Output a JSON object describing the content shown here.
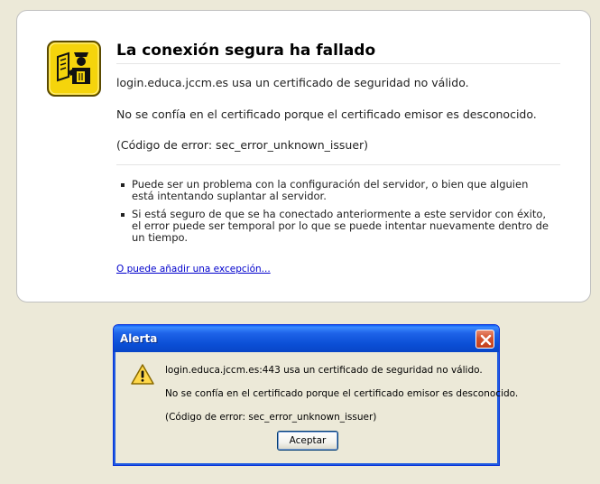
{
  "error_page": {
    "title": "La conexión segura ha fallado",
    "line1": "login.educa.jccm.es usa un certificado de seguridad no válido.",
    "line2": "No se confía en el certificado porque el certificado emisor es desconocido.",
    "line3": "(Código de error: sec_error_unknown_issuer)",
    "bullets": [
      "Puede ser un problema con la configuración del servidor, o bien que alguien está intentando suplantar al servidor.",
      "Si está seguro de que se ha conectado anteriormente a este servidor con éxito, el error puede ser temporal por lo que se puede intentar nuevamente dentro de un tiempo."
    ],
    "exception_link": "O puede añadir una excepción...",
    "icon": "security-officer-icon"
  },
  "alert_dialog": {
    "title": "Alerta",
    "message1": "login.educa.jccm.es:443 usa un certificado de seguridad no válido.",
    "message2": "No se confía en el certificado porque el certificado emisor es desconocido.",
    "message3": "(Código de error: sec_error_unknown_issuer)",
    "accept_label": "Aceptar",
    "icon": "warning-icon",
    "close_icon": "close-icon"
  },
  "colors": {
    "link": "#0000cc",
    "titlebar": "#0b4fd6",
    "close_button": "#d2522e",
    "background": "#ece9d8",
    "warning_yellow": "#ffd84a"
  }
}
